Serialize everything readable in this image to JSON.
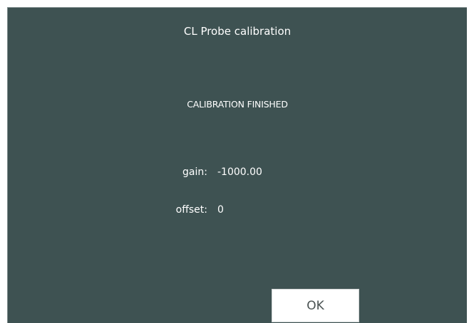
{
  "dialog": {
    "title": "CL Probe calibration",
    "status": "CALIBRATION FINISHED",
    "gain": {
      "label": "gain:",
      "value": "-1000.00"
    },
    "offset": {
      "label": "offset:",
      "value": "0"
    },
    "ok_label": "OK"
  },
  "colors": {
    "dialog_background": "#3e5252",
    "text": "#ffffff",
    "button_background": "#ffffff",
    "button_text": "#4a5252"
  }
}
